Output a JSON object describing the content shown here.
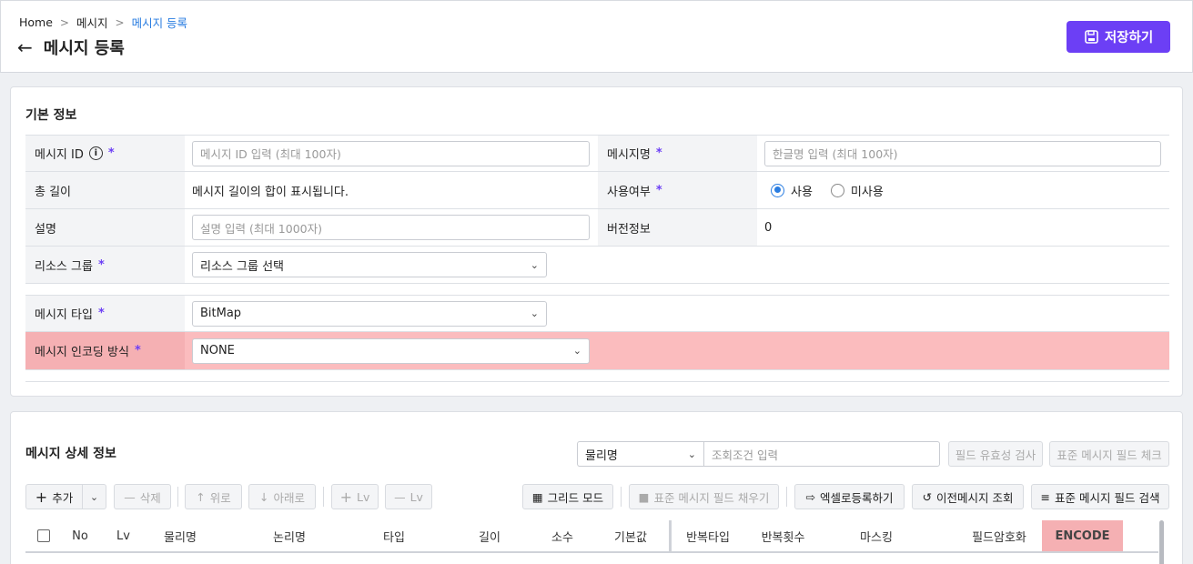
{
  "breadcrumb": {
    "home": "Home",
    "level1": "메시지",
    "current": "메시지 등록",
    "separator": ">"
  },
  "page": {
    "title": "메시지 등록",
    "save_label": "저장하기"
  },
  "basic": {
    "title": "기본 정보",
    "message_id": {
      "label": "메시지 ID",
      "required": "*",
      "placeholder": "메시지 ID 입력 (최대 100자)"
    },
    "message_name": {
      "label": "메시지명",
      "required": "*",
      "placeholder": "한글명 입력 (최대 100자)"
    },
    "total_length": {
      "label": "총 길이",
      "value": "메시지 길이의 합이 표시됩니다."
    },
    "usage": {
      "label": "사용여부",
      "required": "*",
      "options": [
        "사용",
        "미사용"
      ],
      "selected": "사용"
    },
    "description": {
      "label": "설명",
      "placeholder": "설명 입력 (최대 1000자)"
    },
    "version": {
      "label": "버전정보",
      "value": "0"
    },
    "resource_group": {
      "label": "리소스 그룹",
      "required": "*",
      "value": "리소스 그룹 선택"
    },
    "message_type": {
      "label": "메시지 타입",
      "required": "*",
      "value": "BitMap"
    },
    "encoding": {
      "label": "메시지 인코딩 방식",
      "required": "*",
      "value": "NONE"
    }
  },
  "detail": {
    "title": "메시지 상세 정보",
    "search_field": "물리명",
    "search_placeholder": "조회조건 입력",
    "validate_label": "필드 유효성 검사",
    "std_check_label": "표준 메시지 필드 체크",
    "toolbar": {
      "add": "추가",
      "delete": "삭제",
      "up": "위로",
      "down": "아래로",
      "lv_plus": "Lv",
      "lv_minus": "Lv",
      "grid_mode": "그리드 모드",
      "std_fill": "표준 메시지 필드 채우기",
      "excel": "엑셀로등록하기",
      "prev_msg": "이전메시지 조회",
      "std_search": "표준 메시지 필드 검색"
    },
    "columns": [
      "No",
      "Lv",
      "물리명",
      "논리명",
      "타입",
      "길이",
      "소수",
      "기본값",
      "반복타입",
      "반복횟수",
      "마스킹",
      "필드암호화",
      "ENCODE"
    ]
  },
  "colors": {
    "accent": "#6c3ff5",
    "link": "#2a7de1",
    "highlight": "#fbbcbe"
  }
}
